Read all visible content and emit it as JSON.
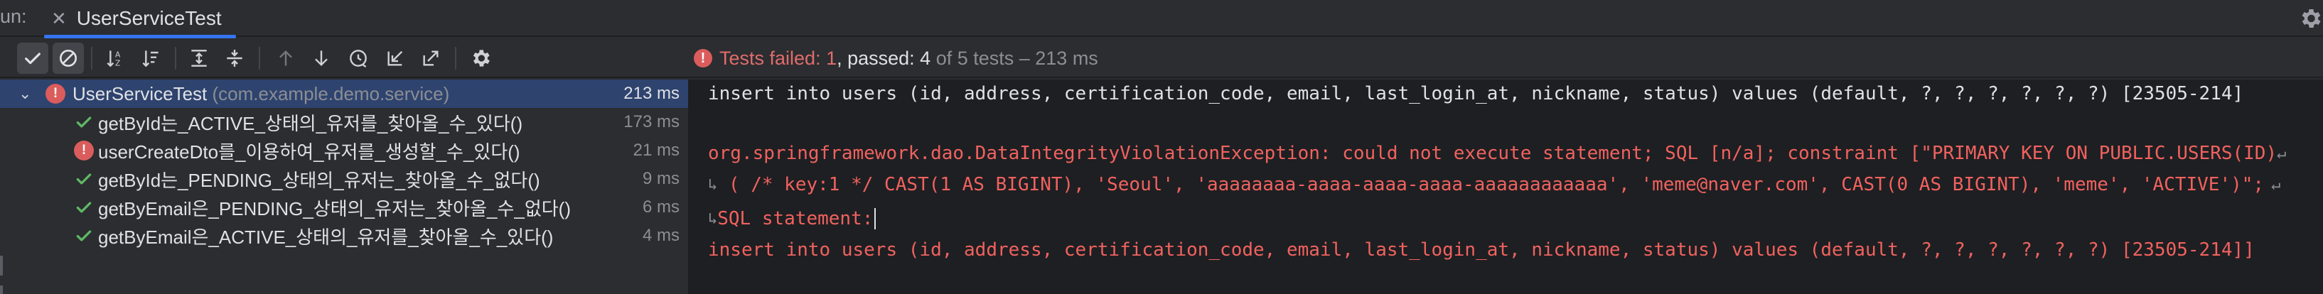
{
  "window": {
    "run_label": "un:",
    "tab_title": "UserServiceTest"
  },
  "toolbar": {
    "buttons": [
      {
        "icon": "show-passed-check-icon",
        "active": true
      },
      {
        "icon": "show-ignored-circle-slash-icon",
        "active": true
      },
      {
        "icon": "sort-alphabetically-icon"
      },
      {
        "icon": "sort-by-duration-icon"
      },
      {
        "icon": "expand-all-icon"
      },
      {
        "icon": "collapse-all-icon"
      },
      {
        "icon": "previous-failed-test-icon"
      },
      {
        "icon": "next-failed-test-icon"
      },
      {
        "icon": "test-history-clock-icon"
      },
      {
        "icon": "import-tests-icon"
      },
      {
        "icon": "export-tests-icon"
      },
      {
        "icon": "settings-gear-icon"
      }
    ],
    "status": {
      "failed_text": "Tests failed: 1",
      "passed_text": ", passed: 4",
      "total_text": " of 5 tests – 213 ms"
    }
  },
  "tree": {
    "root": {
      "name": "UserServiceTest",
      "package": "(com.example.demo.service)",
      "time": "213 ms",
      "status": "failed"
    },
    "items": [
      {
        "name": "getById는_ACTIVE_상태의_유저를_찾아올_수_있다()",
        "time": "173 ms",
        "status": "passed"
      },
      {
        "name": "userCreateDto를_이용하여_유저를_생성할_수_있다()",
        "time": "21 ms",
        "status": "failed"
      },
      {
        "name": "getById는_PENDING_상태의_유저는_찾아올_수_없다()",
        "time": "9 ms",
        "status": "passed"
      },
      {
        "name": "getByEmail은_PENDING_상태의_유저는_찾아올_수_없다()",
        "time": "6 ms",
        "status": "passed"
      },
      {
        "name": "getByEmail은_ACTIVE_상태의_유저를_찾아올_수_있다()",
        "time": "4 ms",
        "status": "passed"
      }
    ]
  },
  "console": {
    "lines": [
      {
        "text": "insert into users (id, address, certification_code, email, last_login_at, nickname, status) values (default, ?, ?, ?, ?, ?, ?) [23505-214]",
        "style": "plain"
      },
      {
        "text": "",
        "style": "plain"
      },
      {
        "text": "org.springframework.dao.DataIntegrityViolationException: could not execute statement; SQL [n/a]; constraint [\"PRIMARY KEY ON PUBLIC.USERS(ID)",
        "style": "red",
        "wrap_end": true
      },
      {
        "text": " ( /* key:1 */ CAST(1 AS BIGINT), 'Seoul', 'aaaaaaaa-aaaa-aaaa-aaaa-aaaaaaaaaaaa', 'meme@naver.com', CAST(0 AS BIGINT), 'meme', 'ACTIVE')\";",
        "style": "red",
        "wrap_start": true,
        "wrap_end": true
      },
      {
        "text": "SQL statement:",
        "style": "red",
        "wrap_start": true,
        "caret": true
      },
      {
        "text": "insert into users (id, address, certification_code, email, last_login_at, nickname, status) values (default, ?, ?, ?, ?, ?, ?) [23505-214]]",
        "style": "red"
      }
    ]
  },
  "colors": {
    "accent": "#3574f0",
    "error": "#f0625f",
    "pass": "#5fb865",
    "selection": "#2e436e"
  }
}
